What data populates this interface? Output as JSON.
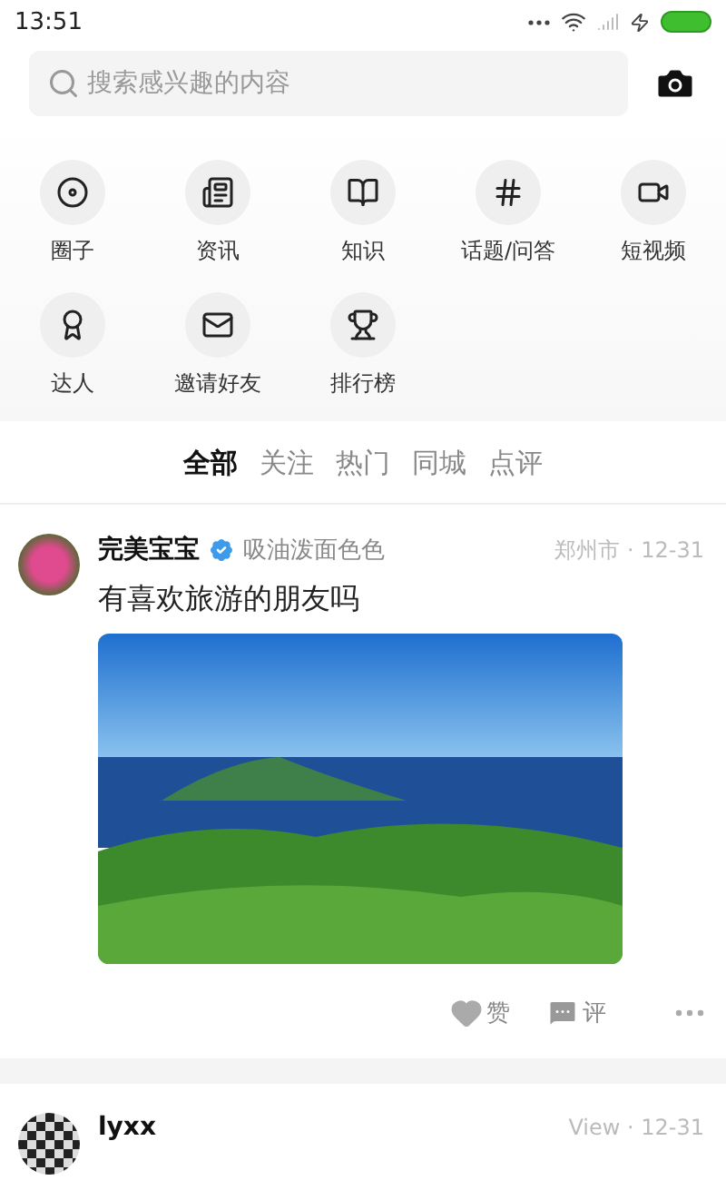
{
  "status_bar": {
    "time": "13:51"
  },
  "search": {
    "placeholder": "搜索感兴趣的内容"
  },
  "shortcuts": [
    {
      "label": "圈子"
    },
    {
      "label": "资讯"
    },
    {
      "label": "知识"
    },
    {
      "label": "话题/问答"
    },
    {
      "label": "短视频"
    },
    {
      "label": "达人"
    },
    {
      "label": "邀请好友"
    },
    {
      "label": "排行榜"
    }
  ],
  "feed_tabs": [
    {
      "label": "全部",
      "selected": true
    },
    {
      "label": "关注",
      "selected": false
    },
    {
      "label": "热门",
      "selected": false
    },
    {
      "label": "同城",
      "selected": false
    },
    {
      "label": "点评",
      "selected": false
    }
  ],
  "posts": [
    {
      "author": "完美宝宝",
      "verified": true,
      "tagline": "吸油泼面色色",
      "meta": "郑州市 · 12-31",
      "text": "有喜欢旅游的朋友吗",
      "has_photo": true,
      "like_label": "赞",
      "comment_label": "评"
    },
    {
      "author": "lyxx",
      "meta": "View · 12-31"
    }
  ]
}
